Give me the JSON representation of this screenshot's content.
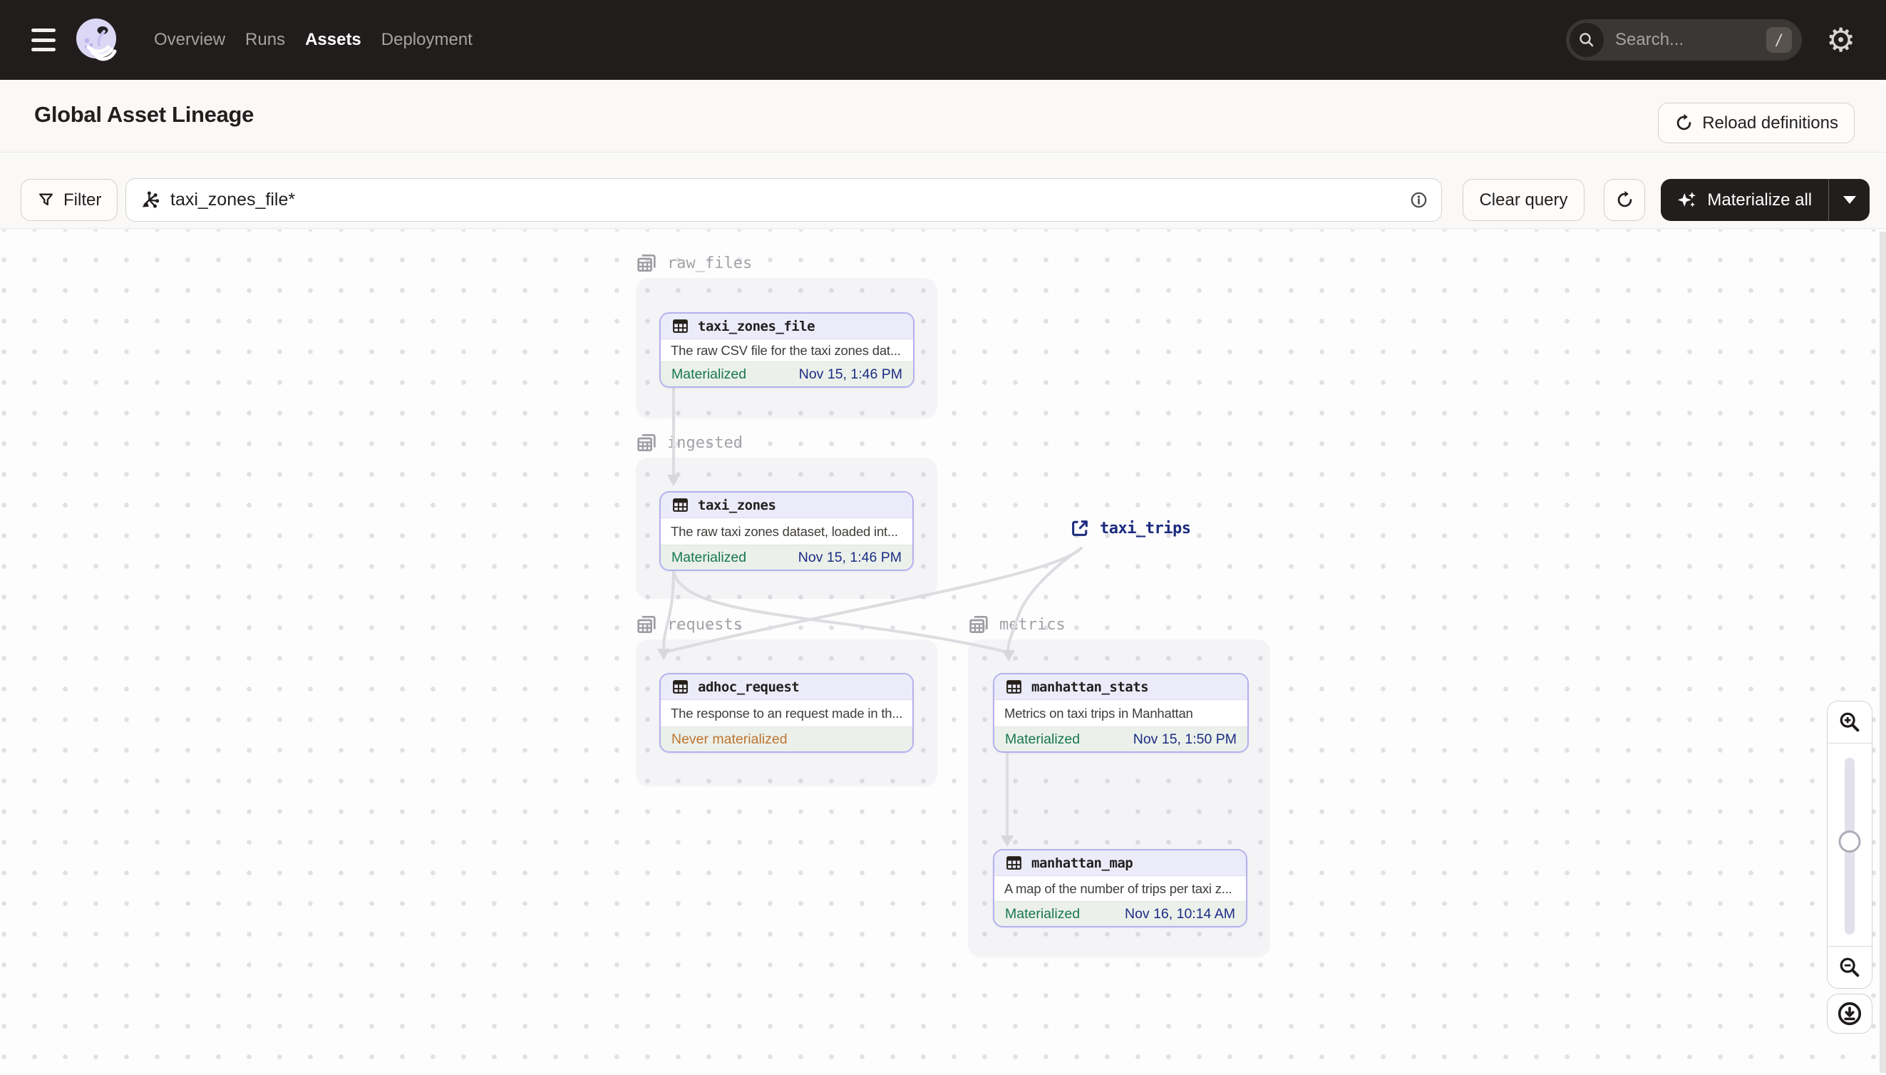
{
  "nav": {
    "links": [
      {
        "label": "Overview",
        "active": false
      },
      {
        "label": "Runs",
        "active": false
      },
      {
        "label": "Assets",
        "active": true
      },
      {
        "label": "Deployment",
        "active": false
      }
    ],
    "search": {
      "placeholder": "Search...",
      "shortcut": "/"
    }
  },
  "header": {
    "title": "Global Asset Lineage",
    "reload_label": "Reload definitions"
  },
  "toolbar": {
    "filter_label": "Filter",
    "query_value": "taxi_zones_file*",
    "clear_label": "Clear query",
    "materialize_label": "Materialize all"
  },
  "graph": {
    "groups": [
      {
        "label": "raw_files"
      },
      {
        "label": "ingested"
      },
      {
        "label": "requests"
      },
      {
        "label": "metrics"
      }
    ],
    "nodes": {
      "taxi_zones_file": {
        "name": "taxi_zones_file",
        "description": "The raw CSV file for the taxi zones dat...",
        "status": "Materialized",
        "timestamp": "Nov 15, 1:46 PM"
      },
      "taxi_zones": {
        "name": "taxi_zones",
        "description": "The raw taxi zones dataset, loaded int...",
        "status": "Materialized",
        "timestamp": "Nov 15, 1:46 PM"
      },
      "adhoc_request": {
        "name": "adhoc_request",
        "description": "The response to an request made in th...",
        "status": "Never materialized",
        "timestamp": ""
      },
      "manhattan_stats": {
        "name": "manhattan_stats",
        "description": "Metrics on taxi trips in Manhattan",
        "status": "Materialized",
        "timestamp": "Nov 15, 1:50 PM"
      },
      "manhattan_map": {
        "name": "manhattan_map",
        "description": "A map of the number of trips per taxi z...",
        "status": "Materialized",
        "timestamp": "Nov 16, 10:14 AM"
      }
    },
    "external": {
      "label": "taxi_trips"
    }
  },
  "colors": {
    "nav_bg": "#211D1C",
    "accent_purple": "#B5B0EF",
    "node_header_bg": "#ECEBFA",
    "materialized_green": "#17784E",
    "never_materialized_orange": "#BE7430",
    "timestamp_navy": "#1B2C85",
    "external_navy": "#1D2B7E",
    "edge_gray": "#DCDCE1"
  }
}
